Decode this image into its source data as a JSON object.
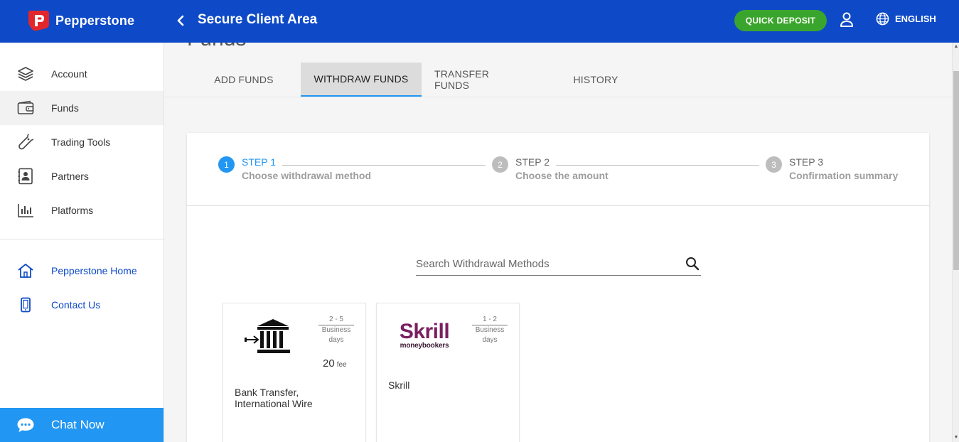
{
  "header": {
    "brand": "Pepperstone",
    "title": "Secure Client Area",
    "quick_deposit": "QUICK DEPOSIT",
    "language": "ENGLISH"
  },
  "sidebar": {
    "items": [
      {
        "label": "Account",
        "icon": "layers-icon"
      },
      {
        "label": "Funds",
        "icon": "wallet-icon"
      },
      {
        "label": "Trading Tools",
        "icon": "wrench-icon"
      },
      {
        "label": "Partners",
        "icon": "contact-card-icon"
      },
      {
        "label": "Platforms",
        "icon": "bar-chart-icon"
      }
    ],
    "links": [
      {
        "label": "Pepperstone Home",
        "icon": "home-icon"
      },
      {
        "label": "Contact Us",
        "icon": "phone-icon"
      }
    ],
    "chat": "Chat Now"
  },
  "main": {
    "page_title": "Funds",
    "tabs": [
      {
        "label": "ADD FUNDS"
      },
      {
        "label": "WITHDRAW FUNDS",
        "active": true
      },
      {
        "label": "TRANSFER FUNDS"
      },
      {
        "label": "HISTORY"
      }
    ],
    "steps": [
      {
        "number": "1",
        "title": "STEP 1",
        "subtitle": "Choose withdrawal method",
        "active": true
      },
      {
        "number": "2",
        "title": "STEP 2",
        "subtitle": "Choose the amount"
      },
      {
        "number": "3",
        "title": "STEP 3",
        "subtitle": "Confirmation summary"
      }
    ],
    "search": {
      "placeholder": "Search Withdrawal Methods"
    },
    "methods": [
      {
        "name_line1": "Bank Transfer,",
        "name_line2": "International Wire",
        "days_range": "2 - 5",
        "days_unit_1": "Business",
        "days_unit_2": "days",
        "fee": "20",
        "fee_unit": "fee",
        "logo": "bank-transfer-icon"
      },
      {
        "name_line1": "Skrill",
        "days_range": "1 - 2",
        "days_unit_1": "Business",
        "days_unit_2": "days",
        "logo_text": "Skrill",
        "logo_sub": "moneybookers"
      }
    ]
  },
  "colors": {
    "header_bg": "#0e4ac7",
    "deposit_green": "#3aa52c",
    "accent_blue": "#2196f3",
    "skrill_purple": "#7a1f60"
  }
}
